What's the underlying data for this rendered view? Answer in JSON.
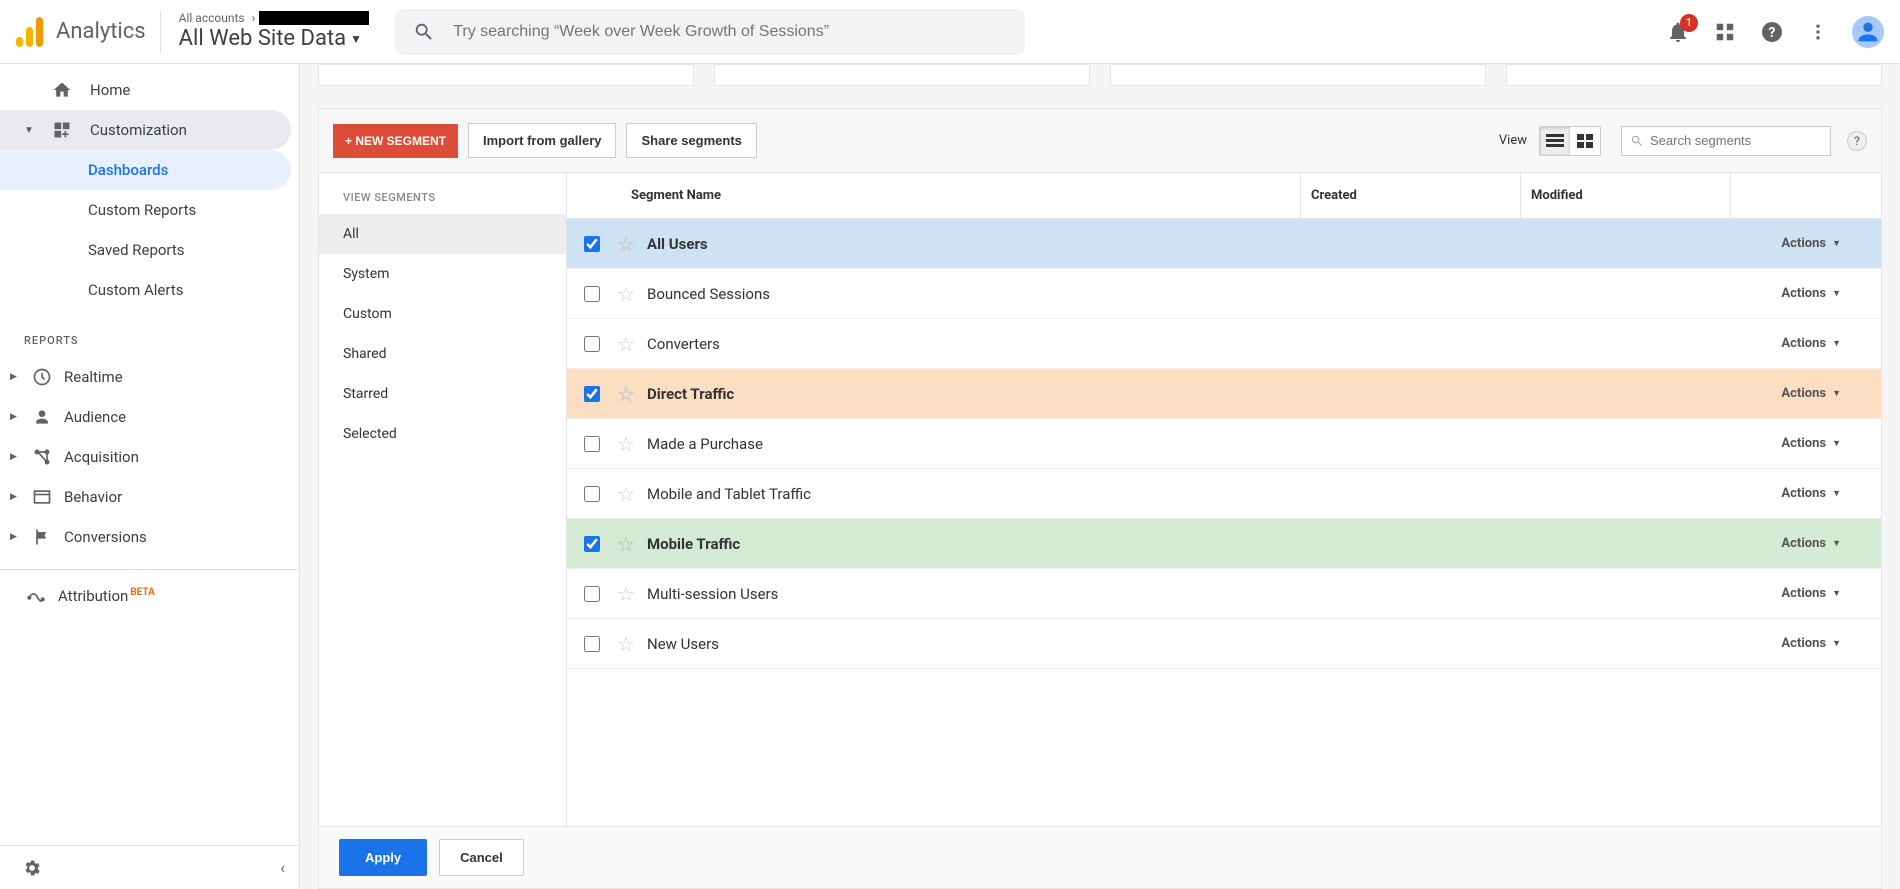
{
  "header": {
    "product": "Analytics",
    "breadcrumb_prefix": "All accounts",
    "view_name": "All Web Site Data",
    "search_placeholder": "Try searching “Week over Week Growth of Sessions”",
    "notification_count": "1"
  },
  "nav": {
    "home": "Home",
    "customization": "Customization",
    "sub": {
      "dashboards": "Dashboards",
      "custom_reports": "Custom Reports",
      "saved_reports": "Saved Reports",
      "custom_alerts": "Custom Alerts"
    },
    "section_reports": "REPORTS",
    "realtime": "Realtime",
    "audience": "Audience",
    "acquisition": "Acquisition",
    "behavior": "Behavior",
    "conversions": "Conversions",
    "attribution": "Attribution",
    "attribution_badge": "BETA"
  },
  "segments": {
    "new_segment": "+ NEW SEGMENT",
    "import": "Import from gallery",
    "share": "Share segments",
    "view_label": "View",
    "search_placeholder": "Search segments",
    "side_header": "VIEW SEGMENTS",
    "side_items": [
      "All",
      "System",
      "Custom",
      "Shared",
      "Starred",
      "Selected"
    ],
    "columns": {
      "name": "Segment Name",
      "created": "Created",
      "modified": "Modified"
    },
    "actions_label": "Actions",
    "rows": [
      {
        "name": "All Users",
        "checked": true,
        "hl": 0
      },
      {
        "name": "Bounced Sessions",
        "checked": false
      },
      {
        "name": "Converters",
        "checked": false
      },
      {
        "name": "Direct Traffic",
        "checked": true,
        "hl": 1
      },
      {
        "name": "Made a Purchase",
        "checked": false
      },
      {
        "name": "Mobile and Tablet Traffic",
        "checked": false
      },
      {
        "name": "Mobile Traffic",
        "checked": true,
        "hl": 2
      },
      {
        "name": "Multi-session Users",
        "checked": false
      },
      {
        "name": "New Users",
        "checked": false
      }
    ],
    "apply": "Apply",
    "cancel": "Cancel"
  }
}
